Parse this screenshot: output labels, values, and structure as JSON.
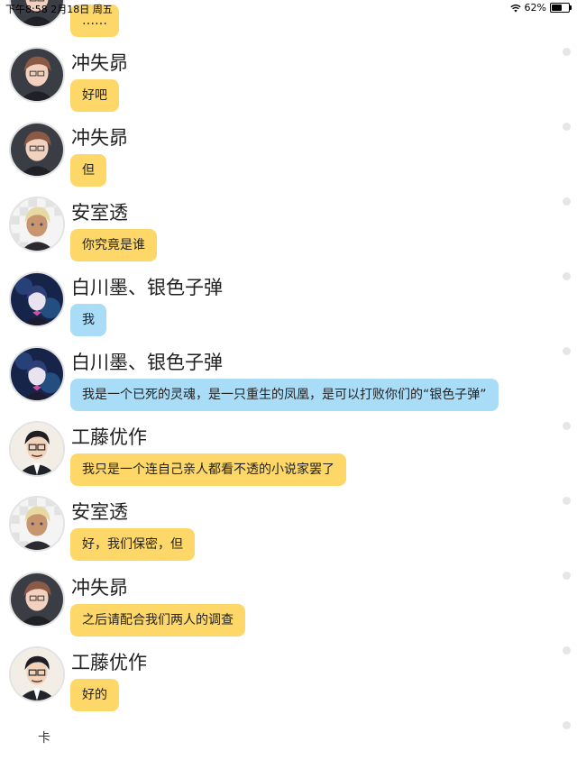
{
  "status_bar": {
    "time_date": "下午8:58   2月18日 周五",
    "battery": "62%",
    "battery_level": 0.62
  },
  "messages": [
    {
      "name": "",
      "text": "……",
      "color": "yellow",
      "avatar": "subaru"
    },
    {
      "name": "冲失昴",
      "text": "好吧",
      "color": "yellow",
      "avatar": "subaru"
    },
    {
      "name": "冲失昴",
      "text": "但",
      "color": "yellow",
      "avatar": "subaru"
    },
    {
      "name": "安室透",
      "text": "你究竟是谁",
      "color": "yellow",
      "avatar": "amuro"
    },
    {
      "name": "白川墨、银色子弹",
      "text": "我",
      "color": "blue",
      "avatar": "bullet"
    },
    {
      "name": "白川墨、银色子弹",
      "text": "我是一个已死的灵魂，是一只重生的凤凰，是可以打败你们的“银色子弹”",
      "color": "blue",
      "avatar": "bullet"
    },
    {
      "name": "工藤优作",
      "text": "我只是一个连自己亲人都看不透的小说家罢了",
      "color": "yellow",
      "avatar": "yusaku"
    },
    {
      "name": "安室透",
      "text": "好，我们保密，但",
      "color": "yellow",
      "avatar": "amuro"
    },
    {
      "name": "冲失昴",
      "text": "之后请配合我们两人的调查",
      "color": "yellow",
      "avatar": "subaru"
    },
    {
      "name": "工藤优作",
      "text": "好的",
      "color": "yellow",
      "avatar": "yusaku"
    }
  ],
  "footer": {
    "text": "卡"
  },
  "colors": {
    "yellow_bubble": "#fdd768",
    "blue_bubble": "#a9dcf7"
  }
}
